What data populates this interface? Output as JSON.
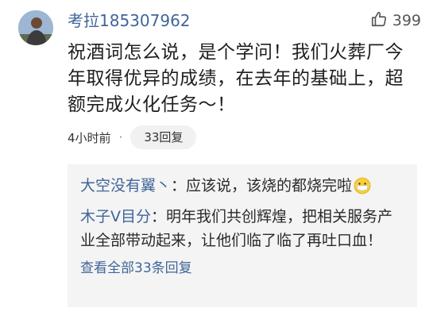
{
  "comment": {
    "username": "考拉185307962",
    "like_count": "399",
    "text": "祝酒词怎么说，是个学问！我们火葬厂今年取得优异的成绩，在去年的基础上，超额完成火化任务～！",
    "time": "4小时前",
    "separator": "·",
    "reply_chip": "33回复"
  },
  "replies": {
    "items": [
      {
        "name": "大空没有翼丶",
        "colon": "：",
        "text": "应该说，该烧的都烧完啦",
        "icon": "mask-face-emoji-icon"
      },
      {
        "name": "木子V目分",
        "colon": "：",
        "text": "明年我们共创辉煌，把相关服务产业全部带动起来，让他们临了临了再吐口血！"
      }
    ],
    "view_all": "查看全部33条回复"
  },
  "colors": {
    "link_blue": "#406599",
    "reply_bg": "#f4f4f4",
    "chip_bg": "#f1f1f1"
  }
}
